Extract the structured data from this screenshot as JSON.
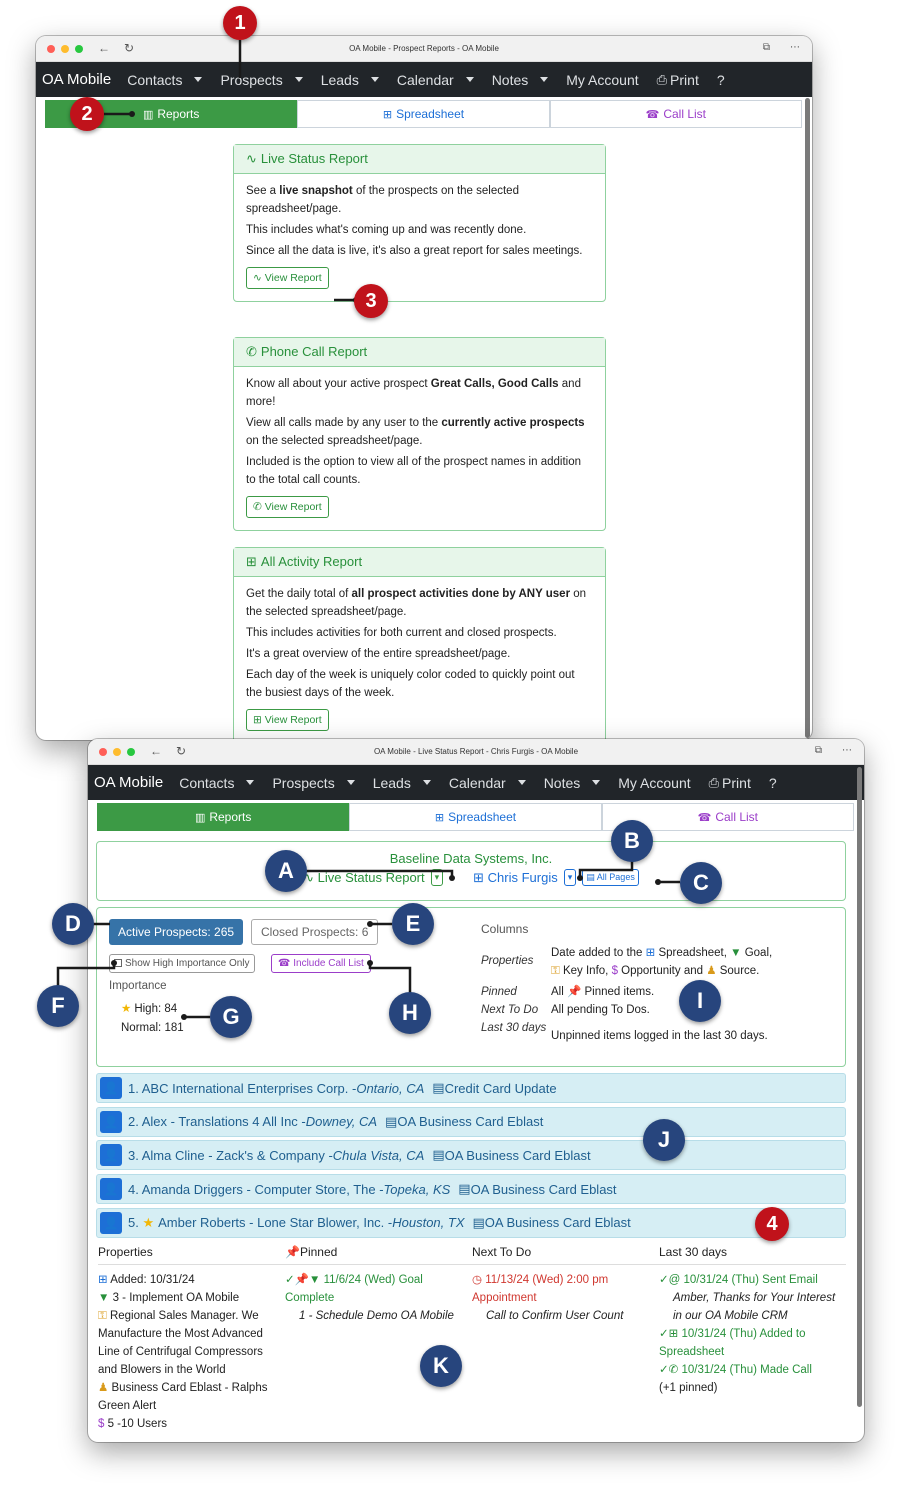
{
  "window1": {
    "title": "OA Mobile - Prospect Reports - OA Mobile",
    "navbar": {
      "brand": "OA Mobile",
      "items": [
        "Contacts",
        "Prospects",
        "Leads",
        "Calendar",
        "Notes"
      ],
      "my_account": "My Account",
      "print": "Print",
      "help": "?"
    },
    "tabs": {
      "reports": "Reports",
      "spreadsheet": "Spreadsheet",
      "call_list": "Call List"
    },
    "cards": [
      {
        "title": "Live Status Report",
        "lines": [
          [
            "See a ",
            "live snapshot",
            " of the prospects on the selected spreadsheet/page."
          ],
          [
            "This includes what's coming up and was recently done.",
            "",
            ""
          ],
          [
            "Since all the data is live, it's also a great report for sales meetings.",
            "",
            ""
          ]
        ],
        "button": "View Report"
      },
      {
        "title": "Phone Call Report",
        "lines": [
          [
            "Know all about your active prospect ",
            "Great Calls, Good Calls",
            " and more!"
          ],
          [
            "View all calls made by any user to the ",
            "currently active prospects",
            " on the selected spreadsheet/page."
          ],
          [
            "Included is the option to view all of the prospect names in addition to the total call counts.",
            "",
            ""
          ]
        ],
        "button": "View Report"
      },
      {
        "title": "All Activity Report",
        "lines": [
          [
            "Get the daily total of ",
            "all prospect activities done by ANY user",
            " on the selected spreadsheet/page."
          ],
          [
            "This includes activities for both current and closed prospects.",
            "",
            ""
          ],
          [
            "It's a great overview of the entire spreadsheet/page.",
            "",
            ""
          ],
          [
            "Each day of the week is uniquely color coded to quickly point out the busiest days of the week.",
            "",
            ""
          ]
        ],
        "button": "View Report"
      }
    ]
  },
  "window2": {
    "title": "OA Mobile - Live Status Report - Chris Furgis - OA Mobile",
    "company": "Baseline Data Systems, Inc.",
    "report_select": "Live Status Report",
    "user_select": "Chris Furgis",
    "pages": "All Pages",
    "active_btn": "Active Prospects: 265",
    "closed_btn": "Closed Prospects: 6",
    "show_high": "Show High Importance Only",
    "include_call": "Include Call List",
    "importance_label": "Importance",
    "high": "High: 84",
    "normal": "Normal: 181",
    "columns_label": "Columns",
    "col_properties_k": "Properties",
    "col_properties_v": [
      "Date added to the",
      "Spreadsheet,",
      "Goal,",
      "Key Info,",
      "Opportunity and",
      "Source."
    ],
    "col_pinned_k": "Pinned",
    "col_pinned_v": [
      "All",
      "Pinned items."
    ],
    "col_next_k": "Next To Do",
    "col_next_v": "All pending To Dos.",
    "col_last_k": "Last 30 days",
    "col_last_v": "Unpinned items logged in the last 30 days.",
    "prospects": [
      {
        "name": "1. ABC International Enterprises Corp. - ",
        "loc": "Ontario, CA",
        "src": "Credit Card Update",
        "star": false
      },
      {
        "name": "2. Alex - Translations 4 All Inc - ",
        "loc": "Downey, CA",
        "src": "OA Business Card Eblast",
        "star": false
      },
      {
        "name": "3. Alma Cline - Zack's & Company - ",
        "loc": "Chula Vista, CA",
        "src": "OA Business Card Eblast",
        "star": false
      },
      {
        "name": "4. Amanda Driggers - Computer Store, The - ",
        "loc": "Topeka, KS",
        "src": "OA Business Card Eblast",
        "star": false
      },
      {
        "name": "Amber Roberts - Lone Star Blower, Inc. - ",
        "loc": "Houston, TX",
        "src": "OA Business Card Eblast",
        "star": true,
        "num": "5."
      }
    ],
    "detail_headers": [
      "Properties",
      "Pinned",
      "Next To Do",
      "Last 30 days"
    ],
    "detail": {
      "added": "Added: 10/31/24",
      "goal": "3 - Implement OA Mobile",
      "key_info": "Regional Sales Manager. We Manufacture the Most Advanced Line of Centrifugal Compressors and Blowers in the World",
      "source": "Business Card Eblast - Ralphs Green Alert",
      "opportunity": "5 -10 Users",
      "pinned_title": "11/6/24 (Wed) Goal Complete",
      "pinned_sub": "1 - Schedule Demo OA Mobile",
      "next_title": "11/13/24 (Wed) 2:00 pm Appointment",
      "next_sub": "Call to Confirm User Count",
      "last1": "10/31/24 (Thu) Sent Email",
      "last1_sub": "Amber, Thanks for Your Interest in our OA Mobile CRM",
      "last2": "10/31/24 (Thu) Added to Spreadsheet",
      "last3": "10/31/24 (Thu) Made Call",
      "last_more": "(+1 pinned)"
    }
  },
  "callouts": {
    "n1": "1",
    "n2": "2",
    "n3": "3",
    "n4": "4",
    "A": "A",
    "B": "B",
    "C": "C",
    "D": "D",
    "E": "E",
    "F": "F",
    "G": "G",
    "H": "H",
    "I": "I",
    "J": "J",
    "K": "K"
  },
  "colors": {
    "nav_bg": "#212529",
    "green": "#3c9a45",
    "blue": "#1d6fd6",
    "purple": "#9b3ec9",
    "callout_red": "#c0121b",
    "callout_navy": "#27457d"
  }
}
